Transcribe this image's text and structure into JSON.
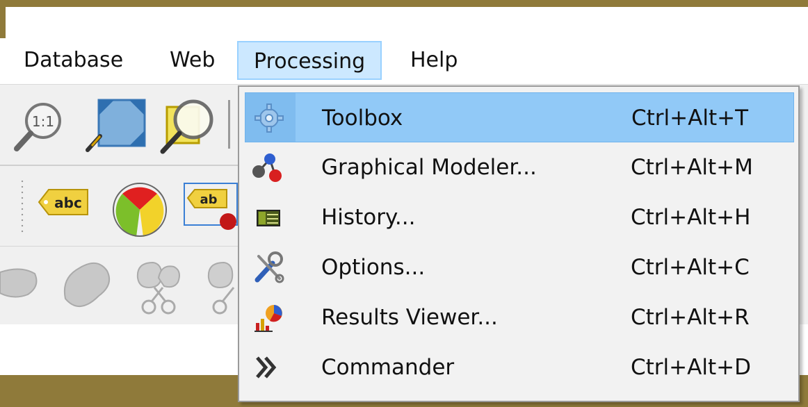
{
  "menubar": {
    "items": [
      {
        "label": "Database"
      },
      {
        "label": "Web"
      },
      {
        "label": "Processing",
        "active": true
      },
      {
        "label": "Help"
      }
    ]
  },
  "toolbar": {
    "row1_icons": [
      "zoom-actual-size-icon",
      "zoom-full-icon",
      "zoom-layer-icon"
    ],
    "row2_icons": [
      "label-abc-icon",
      "pie-diagram-icon",
      "label-pin-icon"
    ],
    "row3_icons": [
      "shape-icon",
      "shape-icon",
      "scissors-icon",
      "scissors-icon"
    ],
    "label_abc": "abc",
    "label_ab": "ab"
  },
  "dropdown": {
    "items": [
      {
        "label": "Toolbox",
        "shortcut": "Ctrl+Alt+T",
        "icon": "gear-icon",
        "highlighted": true
      },
      {
        "label": "Graphical Modeler...",
        "shortcut": "Ctrl+Alt+M",
        "icon": "model-icon"
      },
      {
        "label": "History...",
        "shortcut": "Ctrl+Alt+H",
        "icon": "history-icon"
      },
      {
        "label": "Options...",
        "shortcut": "Ctrl+Alt+C",
        "icon": "tools-icon"
      },
      {
        "label": "Results Viewer...",
        "shortcut": "Ctrl+Alt+R",
        "icon": "results-icon"
      },
      {
        "label": "Commander",
        "shortcut": "Ctrl+Alt+D",
        "icon": "double-chevron-icon"
      }
    ]
  },
  "colors": {
    "frame": "#8f7a3a",
    "menu_active_bg": "#cce8ff",
    "menu_highlight_bg": "#91c9f7"
  }
}
